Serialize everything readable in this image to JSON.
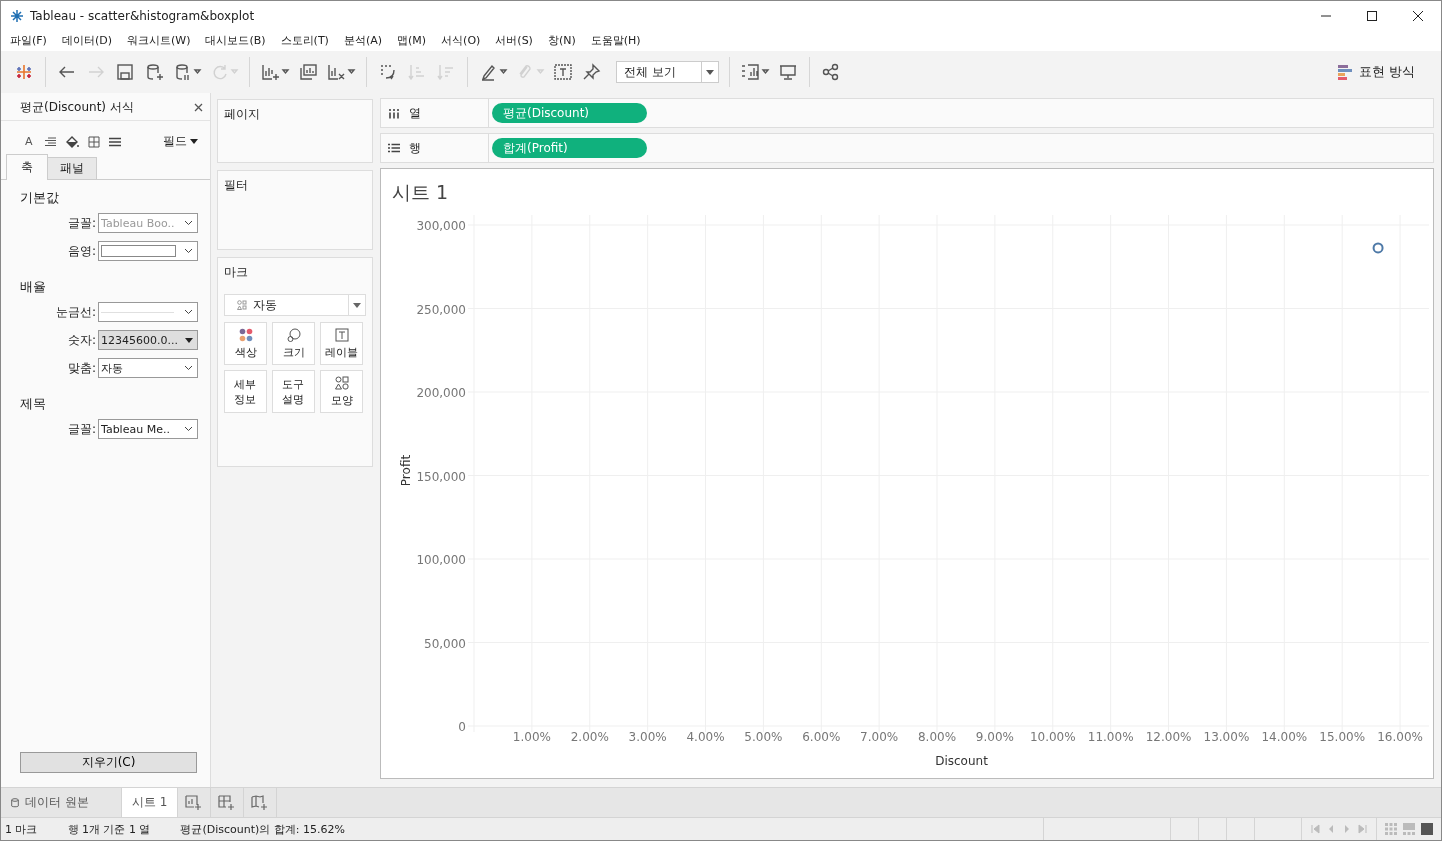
{
  "window": {
    "title": "Tableau - scatter&histogram&boxplot"
  },
  "menu": [
    "파일(F)",
    "데이터(D)",
    "워크시트(W)",
    "대시보드(B)",
    "스토리(T)",
    "분석(A)",
    "맵(M)",
    "서식(O)",
    "서버(S)",
    "창(N)",
    "도움말(H)"
  ],
  "toolbar": [
    [
      {
        "kind": "undo",
        "disabled": false
      },
      {
        "kind": "redo",
        "disabled": true
      },
      {
        "kind": "save",
        "disabled": false
      },
      {
        "kind": "add-source",
        "disabled": false
      },
      {
        "kind": "pause",
        "disabled": false
      },
      {
        "kind": "refresh",
        "disabled": true
      }
    ],
    [
      {
        "kind": "new-sheet",
        "disabled": false
      },
      {
        "kind": "duplicate",
        "disabled": false
      },
      {
        "kind": "clear",
        "disabled": false
      }
    ],
    [
      {
        "kind": "swap",
        "disabled": false
      },
      {
        "kind": "sort-asc",
        "disabled": true
      },
      {
        "kind": "sort-desc",
        "disabled": true
      }
    ],
    [
      {
        "kind": "highlight",
        "disabled": false
      },
      {
        "kind": "clip",
        "disabled": true
      },
      {
        "kind": "label",
        "disabled": false
      },
      {
        "kind": "pin",
        "disabled": false
      }
    ],
    [
      {
        "kind": "chart",
        "disabled": false
      },
      {
        "kind": "present",
        "disabled": false
      }
    ],
    [
      {
        "kind": "share",
        "disabled": false
      }
    ]
  ],
  "view_fit": "전체 보기",
  "show_me": {
    "label": "표현 방식"
  },
  "format_pane": {
    "title": "평균(Discount) 서식",
    "font_button": "A",
    "field_menu": "필드",
    "tabs": [
      {
        "label": "축",
        "selected": true
      },
      {
        "label": "패널",
        "selected": false
      }
    ],
    "sections": [
      {
        "heading": "기본값",
        "rows": [
          {
            "label": "글꼴:",
            "kind": "select",
            "value": "Tableau Boo..",
            "muted": true
          },
          {
            "label": "음영:",
            "kind": "swatch"
          }
        ]
      },
      {
        "heading": "배율",
        "rows": [
          {
            "label": "눈금선:",
            "kind": "line"
          },
          {
            "label": "숫자:",
            "kind": "menu",
            "value": "12345600.0..."
          },
          {
            "label": "맞춤:",
            "kind": "select",
            "value": "자동",
            "muted": false
          }
        ]
      },
      {
        "heading": "제목",
        "rows": [
          {
            "label": "글꼴:",
            "kind": "select",
            "value": "Tableau Me..",
            "muted": false
          }
        ]
      }
    ],
    "clear_button": "지우기(C)"
  },
  "pages_card": {
    "title": "페이지"
  },
  "filters_card": {
    "title": "필터"
  },
  "marks_card": {
    "title": "마크",
    "mark_type": "자동",
    "buttons": [
      {
        "kind": "color",
        "label": "색상"
      },
      {
        "kind": "size",
        "label": "크기"
      },
      {
        "kind": "label",
        "label": "레이블"
      },
      {
        "kind": "detail",
        "label": "세부 정보"
      },
      {
        "kind": "tooltip",
        "label": "도구 설명"
      },
      {
        "kind": "shape",
        "label": "모양"
      }
    ]
  },
  "shelves": [
    {
      "kind": "columns",
      "label": "열",
      "pill": "평균(Discount)"
    },
    {
      "kind": "rows",
      "label": "행",
      "pill": "합계(Profit)"
    }
  ],
  "sheet": {
    "title": "시트 1",
    "chart_data": {
      "type": "scatter",
      "xlabel": "Discount",
      "ylabel": "Profit",
      "xlim": [
        0,
        0.165
      ],
      "ylim": [
        0,
        306000
      ],
      "grid": true,
      "xticks": [
        {
          "value": 0.01,
          "label": "1.00%"
        },
        {
          "value": 0.02,
          "label": "2.00%"
        },
        {
          "value": 0.03,
          "label": "3.00%"
        },
        {
          "value": 0.04,
          "label": "4.00%"
        },
        {
          "value": 0.05,
          "label": "5.00%"
        },
        {
          "value": 0.06,
          "label": "6.00%"
        },
        {
          "value": 0.07,
          "label": "7.00%"
        },
        {
          "value": 0.08,
          "label": "8.00%"
        },
        {
          "value": 0.09,
          "label": "9.00%"
        },
        {
          "value": 0.1,
          "label": "10.00%"
        },
        {
          "value": 0.11,
          "label": "11.00%"
        },
        {
          "value": 0.12,
          "label": "12.00%"
        },
        {
          "value": 0.13,
          "label": "13.00%"
        },
        {
          "value": 0.14,
          "label": "14.00%"
        },
        {
          "value": 0.15,
          "label": "15.00%"
        },
        {
          "value": 0.16,
          "label": "16.00%"
        }
      ],
      "yticks": [
        {
          "value": 0,
          "label": "0"
        },
        {
          "value": 50000,
          "label": "50,000"
        },
        {
          "value": 100000,
          "label": "100,000"
        },
        {
          "value": 150000,
          "label": "150,000"
        },
        {
          "value": 200000,
          "label": "200,000"
        },
        {
          "value": 250000,
          "label": "250,000"
        },
        {
          "value": 300000,
          "label": "300,000"
        }
      ],
      "x": [
        0.1562
      ],
      "series": [
        {
          "color": "#4e79a7",
          "values": [
            286300
          ]
        }
      ]
    }
  },
  "sheet_tabs": [
    {
      "kind": "source",
      "label": "데이터 원본",
      "selected": false
    },
    {
      "kind": "sheet",
      "label": "시트 1",
      "selected": true
    },
    {
      "kind": "new-sheet"
    },
    {
      "kind": "new-dashboard"
    },
    {
      "kind": "new-story"
    }
  ],
  "status_bar": [
    "1 마크",
    "행 1개 기준 1 열",
    "평균(Discount)의 합계: 15.62%"
  ]
}
